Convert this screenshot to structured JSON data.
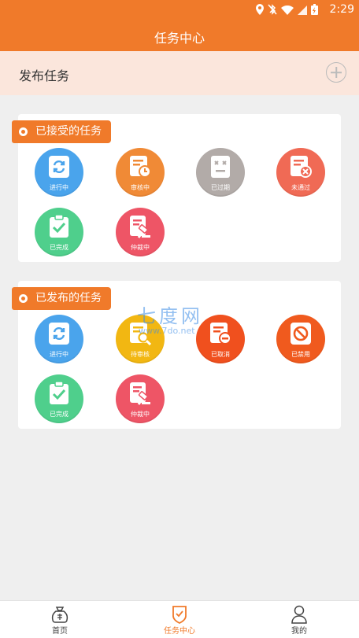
{
  "status_bar": {
    "time": "2:29"
  },
  "app_bar": {
    "title": "任务中心"
  },
  "publish_row": {
    "label": "发布任务"
  },
  "received_section": {
    "title": "已接受的任务",
    "items": [
      {
        "label": "进行中",
        "color": "#4aa4ec"
      },
      {
        "label": "审核中",
        "color": "#f08a36"
      },
      {
        "label": "已过期",
        "color": "#b2aba8"
      },
      {
        "label": "未通过",
        "color": "#f06a55"
      },
      {
        "label": "已完成",
        "color": "#4fcf8c"
      },
      {
        "label": "仲裁中",
        "color": "#ee5566"
      }
    ]
  },
  "published_section": {
    "title": "已发布的任务",
    "items": [
      {
        "label": "进行中",
        "color": "#4aa4ec"
      },
      {
        "label": "待审核",
        "color": "#f2b712"
      },
      {
        "label": "已取消",
        "color": "#f0501e"
      },
      {
        "label": "已禁用",
        "color": "#f05a1e"
      },
      {
        "label": "已完成",
        "color": "#4fcf8c"
      },
      {
        "label": "仲裁中",
        "color": "#ee5566"
      }
    ]
  },
  "watermark": {
    "brand": "七度网",
    "url": "www.7do.net"
  },
  "tab_bar": {
    "tabs": [
      {
        "label": "首页"
      },
      {
        "label": "任务中心"
      },
      {
        "label": "我的"
      }
    ]
  },
  "accent_color": "#f07a2a"
}
